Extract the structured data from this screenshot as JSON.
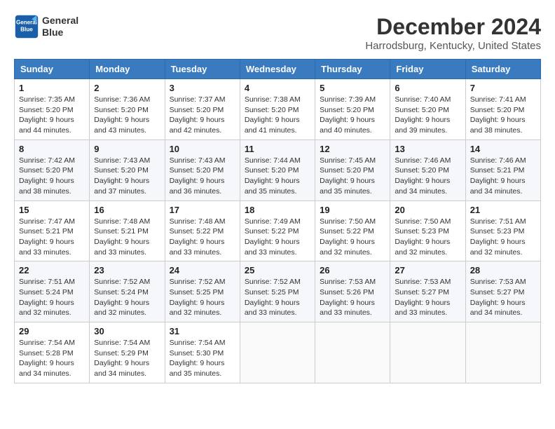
{
  "header": {
    "logo_line1": "General",
    "logo_line2": "Blue",
    "month": "December 2024",
    "location": "Harrodsburg, Kentucky, United States"
  },
  "days_of_week": [
    "Sunday",
    "Monday",
    "Tuesday",
    "Wednesday",
    "Thursday",
    "Friday",
    "Saturday"
  ],
  "weeks": [
    [
      {
        "day": 1,
        "sunrise": "7:35 AM",
        "sunset": "5:20 PM",
        "daylight_hours": 9,
        "daylight_minutes": 44
      },
      {
        "day": 2,
        "sunrise": "7:36 AM",
        "sunset": "5:20 PM",
        "daylight_hours": 9,
        "daylight_minutes": 43
      },
      {
        "day": 3,
        "sunrise": "7:37 AM",
        "sunset": "5:20 PM",
        "daylight_hours": 9,
        "daylight_minutes": 42
      },
      {
        "day": 4,
        "sunrise": "7:38 AM",
        "sunset": "5:20 PM",
        "daylight_hours": 9,
        "daylight_minutes": 41
      },
      {
        "day": 5,
        "sunrise": "7:39 AM",
        "sunset": "5:20 PM",
        "daylight_hours": 9,
        "daylight_minutes": 40
      },
      {
        "day": 6,
        "sunrise": "7:40 AM",
        "sunset": "5:20 PM",
        "daylight_hours": 9,
        "daylight_minutes": 39
      },
      {
        "day": 7,
        "sunrise": "7:41 AM",
        "sunset": "5:20 PM",
        "daylight_hours": 9,
        "daylight_minutes": 38
      }
    ],
    [
      {
        "day": 8,
        "sunrise": "7:42 AM",
        "sunset": "5:20 PM",
        "daylight_hours": 9,
        "daylight_minutes": 38
      },
      {
        "day": 9,
        "sunrise": "7:43 AM",
        "sunset": "5:20 PM",
        "daylight_hours": 9,
        "daylight_minutes": 37
      },
      {
        "day": 10,
        "sunrise": "7:43 AM",
        "sunset": "5:20 PM",
        "daylight_hours": 9,
        "daylight_minutes": 36
      },
      {
        "day": 11,
        "sunrise": "7:44 AM",
        "sunset": "5:20 PM",
        "daylight_hours": 9,
        "daylight_minutes": 35
      },
      {
        "day": 12,
        "sunrise": "7:45 AM",
        "sunset": "5:20 PM",
        "daylight_hours": 9,
        "daylight_minutes": 35
      },
      {
        "day": 13,
        "sunrise": "7:46 AM",
        "sunset": "5:20 PM",
        "daylight_hours": 9,
        "daylight_minutes": 34
      },
      {
        "day": 14,
        "sunrise": "7:46 AM",
        "sunset": "5:21 PM",
        "daylight_hours": 9,
        "daylight_minutes": 34
      }
    ],
    [
      {
        "day": 15,
        "sunrise": "7:47 AM",
        "sunset": "5:21 PM",
        "daylight_hours": 9,
        "daylight_minutes": 33
      },
      {
        "day": 16,
        "sunrise": "7:48 AM",
        "sunset": "5:21 PM",
        "daylight_hours": 9,
        "daylight_minutes": 33
      },
      {
        "day": 17,
        "sunrise": "7:48 AM",
        "sunset": "5:22 PM",
        "daylight_hours": 9,
        "daylight_minutes": 33
      },
      {
        "day": 18,
        "sunrise": "7:49 AM",
        "sunset": "5:22 PM",
        "daylight_hours": 9,
        "daylight_minutes": 33
      },
      {
        "day": 19,
        "sunrise": "7:50 AM",
        "sunset": "5:22 PM",
        "daylight_hours": 9,
        "daylight_minutes": 32
      },
      {
        "day": 20,
        "sunrise": "7:50 AM",
        "sunset": "5:23 PM",
        "daylight_hours": 9,
        "daylight_minutes": 32
      },
      {
        "day": 21,
        "sunrise": "7:51 AM",
        "sunset": "5:23 PM",
        "daylight_hours": 9,
        "daylight_minutes": 32
      }
    ],
    [
      {
        "day": 22,
        "sunrise": "7:51 AM",
        "sunset": "5:24 PM",
        "daylight_hours": 9,
        "daylight_minutes": 32
      },
      {
        "day": 23,
        "sunrise": "7:52 AM",
        "sunset": "5:24 PM",
        "daylight_hours": 9,
        "daylight_minutes": 32
      },
      {
        "day": 24,
        "sunrise": "7:52 AM",
        "sunset": "5:25 PM",
        "daylight_hours": 9,
        "daylight_minutes": 32
      },
      {
        "day": 25,
        "sunrise": "7:52 AM",
        "sunset": "5:25 PM",
        "daylight_hours": 9,
        "daylight_minutes": 33
      },
      {
        "day": 26,
        "sunrise": "7:53 AM",
        "sunset": "5:26 PM",
        "daylight_hours": 9,
        "daylight_minutes": 33
      },
      {
        "day": 27,
        "sunrise": "7:53 AM",
        "sunset": "5:27 PM",
        "daylight_hours": 9,
        "daylight_minutes": 33
      },
      {
        "day": 28,
        "sunrise": "7:53 AM",
        "sunset": "5:27 PM",
        "daylight_hours": 9,
        "daylight_minutes": 34
      }
    ],
    [
      {
        "day": 29,
        "sunrise": "7:54 AM",
        "sunset": "5:28 PM",
        "daylight_hours": 9,
        "daylight_minutes": 34
      },
      {
        "day": 30,
        "sunrise": "7:54 AM",
        "sunset": "5:29 PM",
        "daylight_hours": 9,
        "daylight_minutes": 34
      },
      {
        "day": 31,
        "sunrise": "7:54 AM",
        "sunset": "5:30 PM",
        "daylight_hours": 9,
        "daylight_minutes": 35
      },
      null,
      null,
      null,
      null
    ]
  ],
  "labels": {
    "sunrise": "Sunrise:",
    "sunset": "Sunset:",
    "daylight": "Daylight:"
  }
}
